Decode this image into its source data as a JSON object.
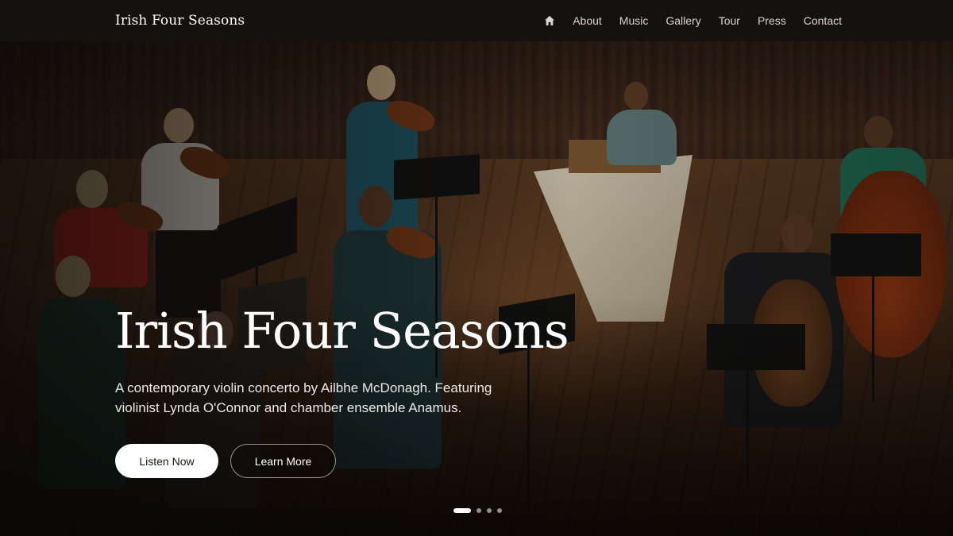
{
  "nav": {
    "brand": "Irish Four Seasons",
    "home_icon": "home-icon",
    "links": [
      "About",
      "Music",
      "Gallery",
      "Tour",
      "Press",
      "Contact"
    ]
  },
  "hero": {
    "title": "Irish Four Seasons",
    "description": "A contemporary violin concerto by Ailbhe McDonagh. Featuring violinist Lynda O'Connor and chamber ensemble Anamus.",
    "primary_button": "Listen Now",
    "secondary_button": "Learn More"
  },
  "carousel": {
    "slide_count": 4,
    "active_index": 0
  },
  "colors": {
    "navbar_bg": "#14110f",
    "primary_button_bg": "#ffffff",
    "text": "#ffffff"
  }
}
